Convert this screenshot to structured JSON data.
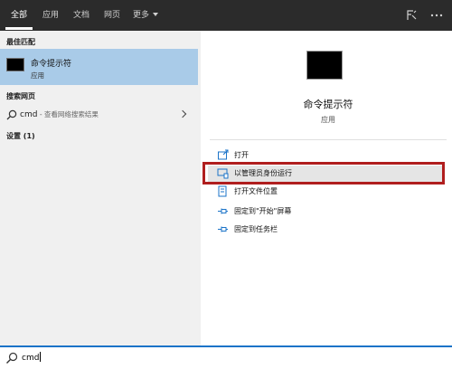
{
  "tabs": [
    {
      "label": "全部",
      "active": true
    },
    {
      "label": "应用",
      "active": false
    },
    {
      "label": "文档",
      "active": false
    },
    {
      "label": "网页",
      "active": false
    },
    {
      "label": "更多",
      "active": false
    }
  ],
  "sections": {
    "best_match": "最佳匹配",
    "web_search": "搜索网页",
    "settings": "设置 (1)"
  },
  "best_match_item": {
    "title": "命令提示符",
    "subtitle": "应用"
  },
  "web_item": {
    "query": "cmd",
    "hint": " - 查看网络搜索结果"
  },
  "details": {
    "title": "命令提示符",
    "subtitle": "应用"
  },
  "actions": [
    {
      "label": "打开",
      "icon": "open-icon"
    },
    {
      "label": "以管理员身份运行",
      "icon": "run-as-admin-icon",
      "highlighted": true
    },
    {
      "label": "打开文件位置",
      "icon": "file-location-icon"
    },
    {
      "label": "固定到\"开始\"屏幕",
      "icon": "pin-start-icon"
    },
    {
      "label": "固定到任务栏",
      "icon": "pin-taskbar-icon"
    }
  ],
  "search": {
    "value": "cmd"
  },
  "colors": {
    "topbar": "#2b2b2b",
    "selection": "#a9cbe8",
    "highlight_border": "#b01e1e",
    "accent": "#1a73c8"
  }
}
